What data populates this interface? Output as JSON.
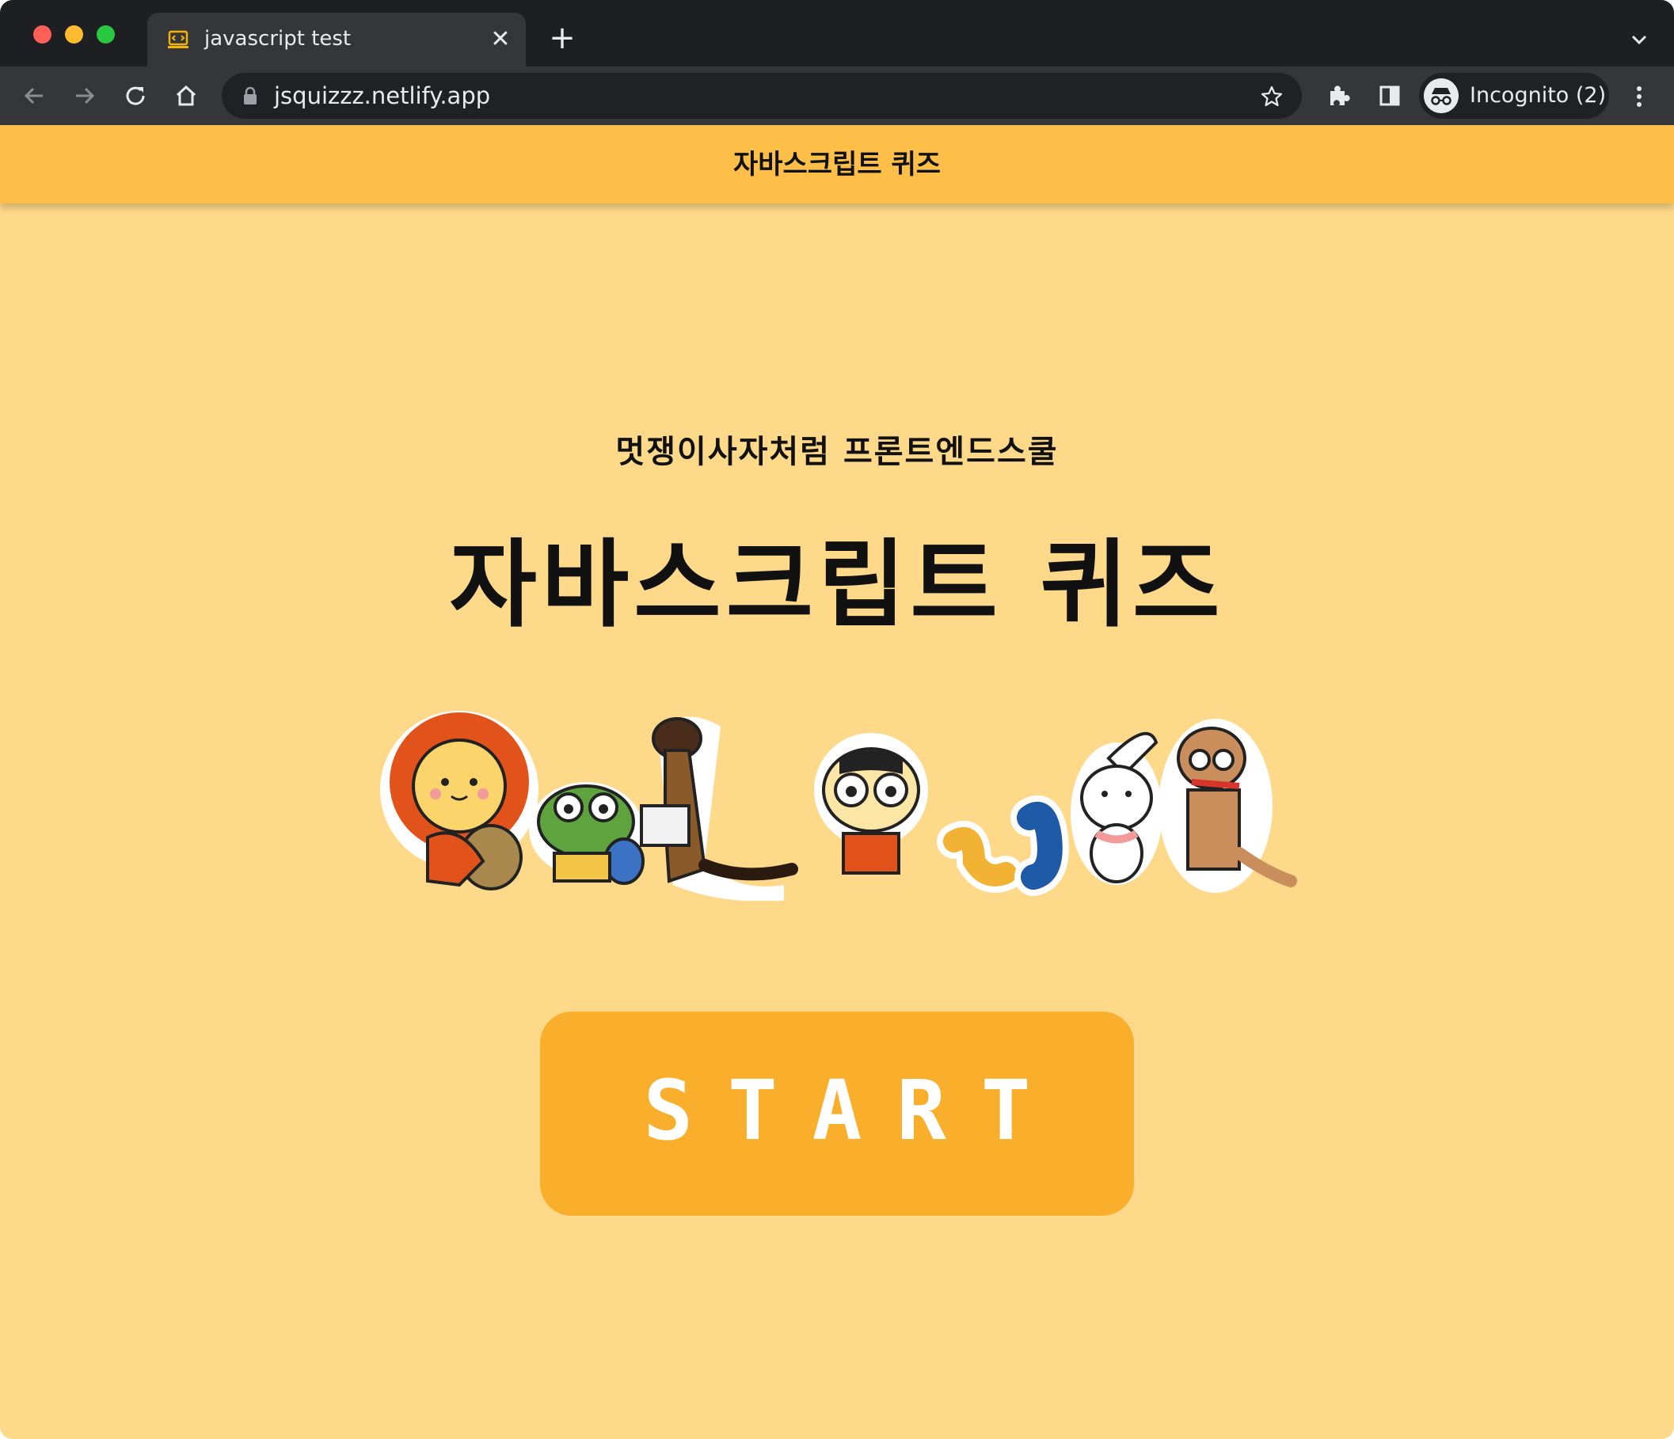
{
  "browser": {
    "tab": {
      "title": "javascript test",
      "close_glyph": "✕",
      "favicon": "code-icon"
    },
    "new_tab_glyph": "+",
    "address_bar": {
      "url": "jsquizzz.netlify.app",
      "secure": true
    },
    "profile": {
      "label": "Incognito (2)"
    },
    "colors": {
      "tab_strip": "#1e1f22",
      "toolbar": "#35363a",
      "omnibox": "#202124"
    }
  },
  "page": {
    "header": {
      "title": "자바스크립트 퀴즈"
    },
    "subtitle": "멋쟁이사자처럼 프론트엔드스쿨",
    "title": "자바스크립트 퀴즈",
    "illustration": "characters-illustration",
    "start_button": {
      "label": "START"
    },
    "colors": {
      "background": "#ffd98a",
      "header": "#fdbf47",
      "button": "#f9ae2c"
    }
  }
}
